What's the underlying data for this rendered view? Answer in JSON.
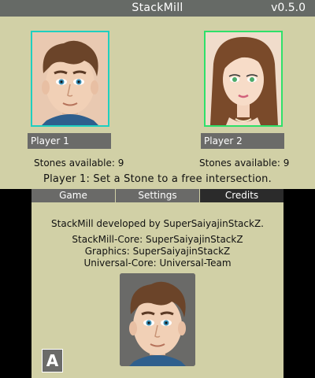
{
  "window": {
    "title": "StackMill",
    "version": "v0.5.0"
  },
  "players": [
    {
      "name": "Player 1",
      "stones": "Stones available: 9"
    },
    {
      "name": "Player 2",
      "stones": "Stones available: 9"
    }
  ],
  "status": "Player 1: Set a Stone to a free intersection.",
  "tabs": [
    {
      "label": "Game"
    },
    {
      "label": "Settings"
    },
    {
      "label": "Credits",
      "active": true
    }
  ],
  "credits": {
    "developed_by": "StackMill developed by SuperSaiyajinStackZ.",
    "core": "StackMill-Core: SuperSaiyajinStackZ",
    "graphics": "Graphics: SuperSaiyajinStackZ",
    "universal": "Universal-Core: Universal-Team"
  },
  "button_a": "A",
  "colors": {
    "background": "#d1d0a6",
    "titlebar": "#666a66",
    "player1_border": "#1fcfc0",
    "player2_border": "#2fe06a",
    "active_tab": "#2b2b2b"
  }
}
